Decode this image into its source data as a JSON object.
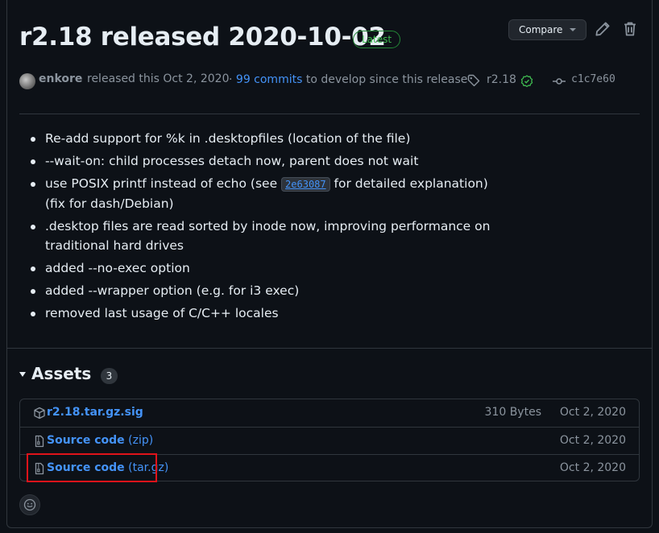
{
  "release": {
    "title": "r2.18 released 2020-10-02",
    "latest_badge": "Latest",
    "compare_label": "Compare",
    "author": "enkore",
    "released_text": "released this Oct 2, 2020",
    "commits_prefix": "· ",
    "commits_link": "99 commits",
    "commits_suffix": " to develop since this release",
    "tag": "r2.18",
    "commit_sha": "c1c7e60"
  },
  "notes": {
    "items": [
      "Re-add support for %k in .desktopfiles (location of the file)",
      "--wait-on: child processes detach now, parent does not wait",
      {
        "before": "use POSIX printf instead of echo (see ",
        "code": "2e63087",
        "after": " for detailed explanation) (fix for dash/Debian)"
      },
      ".desktop files are read sorted by inode now, improving performance on traditional hard drives",
      "added --no-exec option",
      "added --wrapper option (e.g. for i3 exec)",
      "removed last usage of C/C++ locales"
    ]
  },
  "assets": {
    "heading": "Assets",
    "count": "3",
    "rows": [
      {
        "name": "r2.18.tar.gz.sig",
        "sub": "",
        "size": "310 Bytes",
        "date": "Oct 2, 2020",
        "icon": "package-icon"
      },
      {
        "name": "Source code",
        "sub": " (zip)",
        "size": "",
        "date": "Oct 2, 2020",
        "icon": "file-zip-icon"
      },
      {
        "name": "Source code",
        "sub": " (tar.gz)",
        "size": "",
        "date": "Oct 2, 2020",
        "icon": "file-zip-icon"
      }
    ]
  },
  "colors": {
    "background": "#0d1117",
    "link": "#4493f8",
    "latest_green": "#3fb950",
    "highlight_red": "#e0131a"
  }
}
